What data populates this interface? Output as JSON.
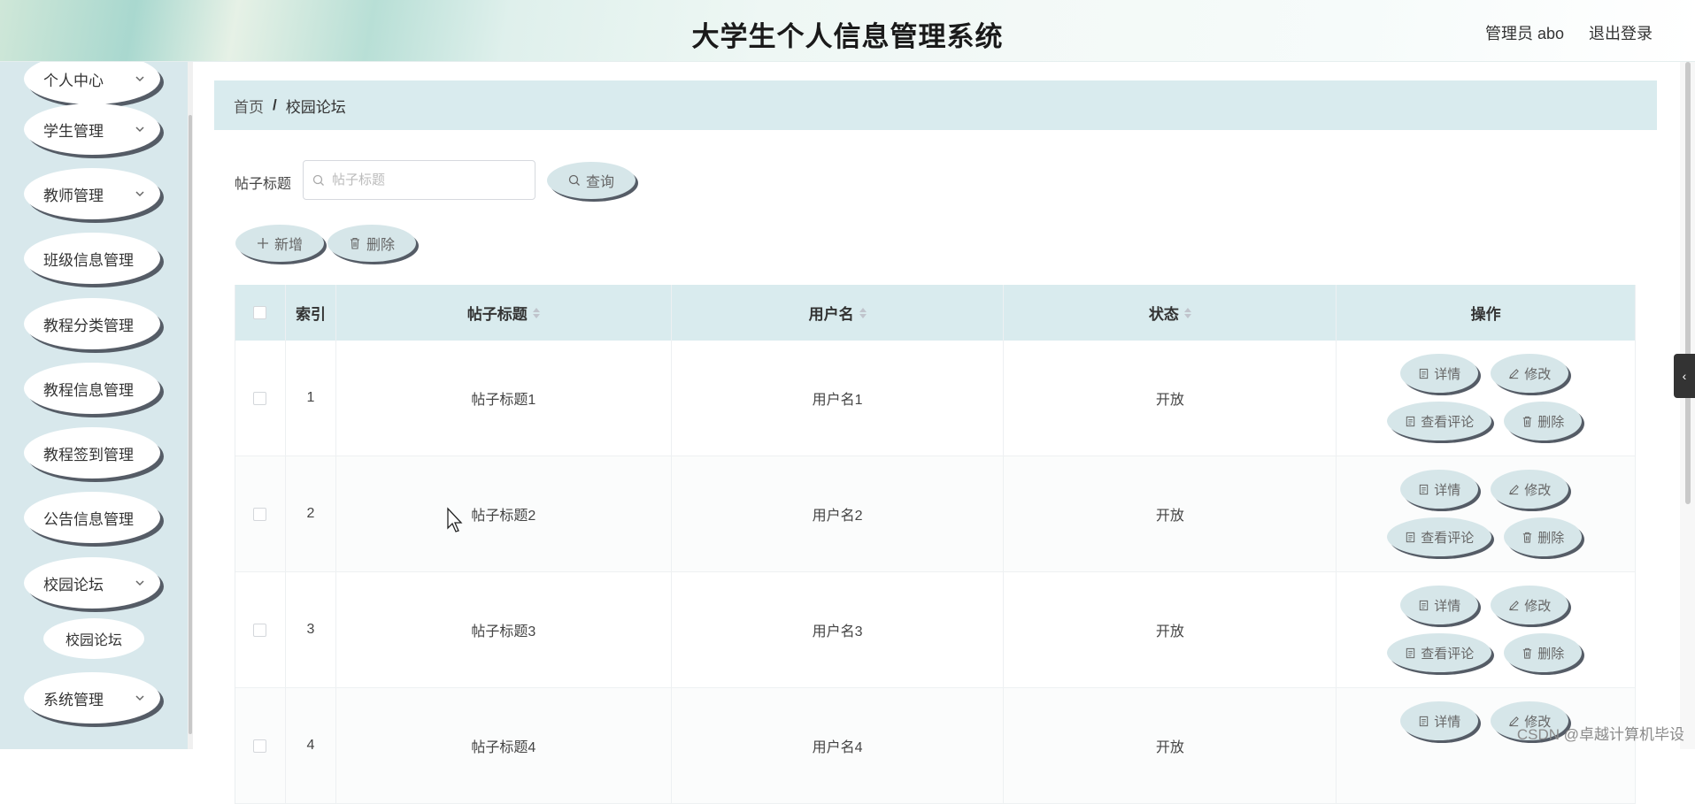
{
  "header": {
    "title": "大学生个人信息管理系统",
    "user": "管理员 abo",
    "logout": "退出登录"
  },
  "sidebar": {
    "items": [
      {
        "label": "个人中心"
      },
      {
        "label": "学生管理"
      },
      {
        "label": "教师管理"
      },
      {
        "label": "班级信息管理"
      },
      {
        "label": "教程分类管理"
      },
      {
        "label": "教程信息管理"
      },
      {
        "label": "教程签到管理"
      },
      {
        "label": "公告信息管理"
      },
      {
        "label": "校园论坛"
      },
      {
        "label": "系统管理"
      }
    ],
    "submenu": {
      "label": "校园论坛"
    }
  },
  "breadcrumb": {
    "home": "首页",
    "separator": "/",
    "current": "校园论坛"
  },
  "search": {
    "label": "帖子标题",
    "placeholder": "帖子标题",
    "value": "",
    "button": "查询"
  },
  "toolbar": {
    "add": "新增",
    "delete": "删除"
  },
  "table": {
    "columns": {
      "index": "索引",
      "title": "帖子标题",
      "username": "用户名",
      "status": "状态",
      "actions": "操作"
    },
    "actions": {
      "detail": "详情",
      "edit": "修改",
      "comments": "查看评论",
      "delete": "删除"
    },
    "rows": [
      {
        "index": "1",
        "title": "帖子标题1",
        "username": "用户名1",
        "status": "开放"
      },
      {
        "index": "2",
        "title": "帖子标题2",
        "username": "用户名2",
        "status": "开放"
      },
      {
        "index": "3",
        "title": "帖子标题3",
        "username": "用户名3",
        "status": "开放"
      },
      {
        "index": "4",
        "title": "帖子标题4",
        "username": "用户名4",
        "status": "开放"
      }
    ]
  },
  "watermark": "CSDN @卓越计算机毕设",
  "colors": {
    "sidebar_bg": "#d8e8ec",
    "header_bg": "#dff0ec",
    "pill_bg": "#d6e6e9",
    "shadow": "#555c66"
  }
}
